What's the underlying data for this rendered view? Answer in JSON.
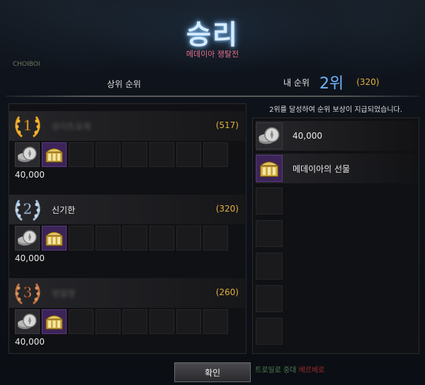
{
  "header": {
    "title": "승리",
    "subtitle": "메데이아 쟁탈전",
    "corner_tag": "CHOIBOI"
  },
  "top_ranking": {
    "section_title": "상위 순위",
    "entries": [
      {
        "rank": "1",
        "medal": "gold-laurel-medal-icon",
        "name": "유이트로제",
        "name_blurred": true,
        "points": "(517)",
        "reward_amount": "40,000"
      },
      {
        "rank": "2",
        "medal": "silver-laurel-medal-icon",
        "name": "신기한",
        "name_blurred": false,
        "points": "(320)",
        "reward_amount": "40,000"
      },
      {
        "rank": "3",
        "medal": "bronze-laurel-medal-icon",
        "name": "명월명",
        "name_blurred": true,
        "points": "(260)",
        "reward_amount": "40,000"
      }
    ]
  },
  "my_ranking": {
    "label": "내 순위",
    "rank": "2위",
    "points": "(320)",
    "note": "2위를 달성하여 순위 보상이 지급되었습니다.",
    "rewards": [
      {
        "icon": "silver-coins-icon",
        "label": "40,000"
      },
      {
        "icon": "treasure-chest-icon",
        "label": "메데이아의 선물"
      }
    ]
  },
  "footer": {
    "confirm_label": "확인",
    "bg_left_text": "",
    "bg_right_green": "트로일로 중대",
    "bg_right_red": "베르베로"
  },
  "colors": {
    "points": "#e2b13c",
    "my_rank": "#6eb6ff",
    "subtitle": "#e36c8a",
    "title_glow": "#78beff"
  }
}
